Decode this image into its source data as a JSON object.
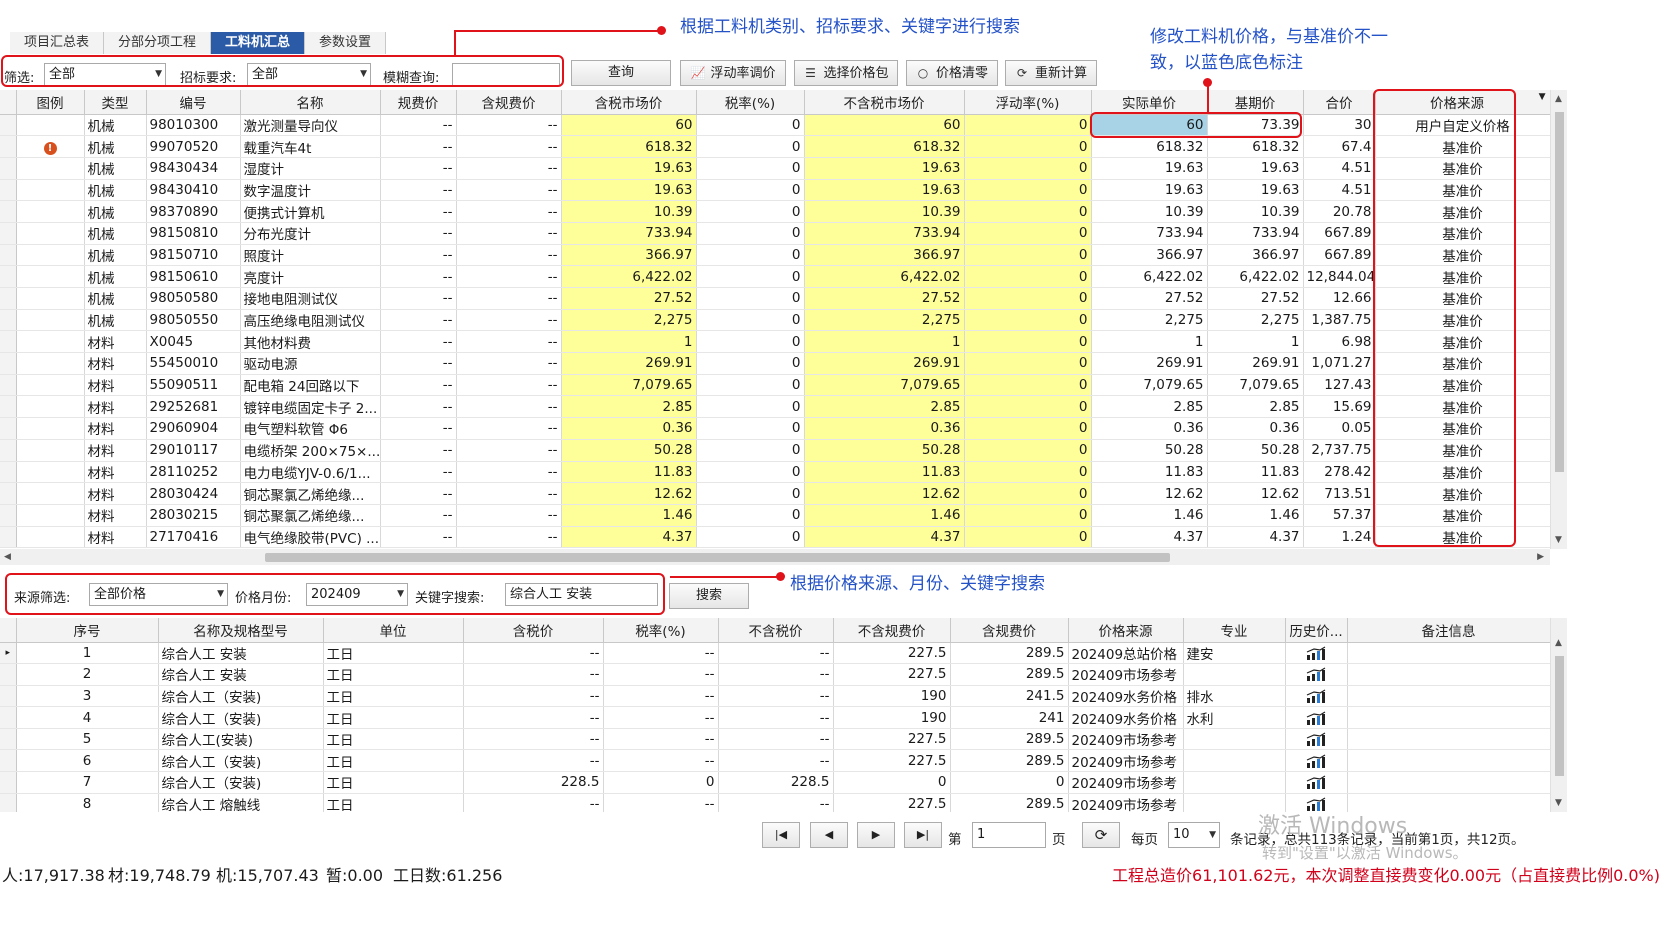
{
  "tabs": [
    {
      "label": "项目汇总表",
      "active": false
    },
    {
      "label": "分部分项工程",
      "active": false
    },
    {
      "label": "工料机汇总",
      "active": true
    },
    {
      "label": "参数设置",
      "active": false
    }
  ],
  "toolbar": {
    "filter_label": "筛选:",
    "filter_value": "全部",
    "bid_label": "招标要求:",
    "bid_value": "全部",
    "fuzzy_label": "模糊查询:",
    "fuzzy_value": "",
    "query_btn": "查询",
    "float_rate_btn": "浮动率调价",
    "select_pkg_btn": "选择价格包",
    "clear_price_btn": "价格清零",
    "recalc_btn": "重新计算"
  },
  "grid1": {
    "columns": [
      "图例",
      "类型",
      "编号",
      "名称",
      "规费价",
      "含规费价",
      "含税市场价",
      "税率(%)",
      "不含税市场价",
      "浮动率(%)",
      "实际单价",
      "基期价",
      "合价",
      "价格来源"
    ],
    "rows": [
      {
        "icon": "",
        "type": "机械",
        "code": "98010300",
        "name": "激光测量导向仪",
        "fee": "--",
        "withfee": "--",
        "taxprice": "60",
        "rate": "0",
        "notax": "60",
        "float": "0",
        "actual": "60",
        "base": "73.39",
        "total": "30",
        "source": "用户自定义价格",
        "highlight": true
      },
      {
        "icon": "warning",
        "type": "机械",
        "code": "99070520",
        "name": "载重汽车4t",
        "fee": "--",
        "withfee": "--",
        "taxprice": "618.32",
        "rate": "0",
        "notax": "618.32",
        "float": "0",
        "actual": "618.32",
        "base": "618.32",
        "total": "67.4",
        "source": "基准价"
      },
      {
        "icon": "",
        "type": "机械",
        "code": "98430434",
        "name": "湿度计",
        "fee": "--",
        "withfee": "--",
        "taxprice": "19.63",
        "rate": "0",
        "notax": "19.63",
        "float": "0",
        "actual": "19.63",
        "base": "19.63",
        "total": "4.51",
        "source": "基准价"
      },
      {
        "icon": "",
        "type": "机械",
        "code": "98430410",
        "name": "数字温度计",
        "fee": "--",
        "withfee": "--",
        "taxprice": "19.63",
        "rate": "0",
        "notax": "19.63",
        "float": "0",
        "actual": "19.63",
        "base": "19.63",
        "total": "4.51",
        "source": "基准价"
      },
      {
        "icon": "",
        "type": "机械",
        "code": "98370890",
        "name": "便携式计算机",
        "fee": "--",
        "withfee": "--",
        "taxprice": "10.39",
        "rate": "0",
        "notax": "10.39",
        "float": "0",
        "actual": "10.39",
        "base": "10.39",
        "total": "20.78",
        "source": "基准价"
      },
      {
        "icon": "",
        "type": "机械",
        "code": "98150810",
        "name": "分布光度计",
        "fee": "--",
        "withfee": "--",
        "taxprice": "733.94",
        "rate": "0",
        "notax": "733.94",
        "float": "0",
        "actual": "733.94",
        "base": "733.94",
        "total": "667.89",
        "source": "基准价"
      },
      {
        "icon": "",
        "type": "机械",
        "code": "98150710",
        "name": "照度计",
        "fee": "--",
        "withfee": "--",
        "taxprice": "366.97",
        "rate": "0",
        "notax": "366.97",
        "float": "0",
        "actual": "366.97",
        "base": "366.97",
        "total": "667.89",
        "source": "基准价"
      },
      {
        "icon": "",
        "type": "机械",
        "code": "98150610",
        "name": "亮度计",
        "fee": "--",
        "withfee": "--",
        "taxprice": "6,422.02",
        "rate": "0",
        "notax": "6,422.02",
        "float": "0",
        "actual": "6,422.02",
        "base": "6,422.02",
        "total": "12,844.04",
        "source": "基准价"
      },
      {
        "icon": "",
        "type": "机械",
        "code": "98050580",
        "name": "接地电阻测试仪",
        "fee": "--",
        "withfee": "--",
        "taxprice": "27.52",
        "rate": "0",
        "notax": "27.52",
        "float": "0",
        "actual": "27.52",
        "base": "27.52",
        "total": "12.66",
        "source": "基准价"
      },
      {
        "icon": "",
        "type": "机械",
        "code": "98050550",
        "name": "高压绝缘电阻测试仪",
        "fee": "--",
        "withfee": "--",
        "taxprice": "2,275",
        "rate": "0",
        "notax": "2,275",
        "float": "0",
        "actual": "2,275",
        "base": "2,275",
        "total": "1,387.75",
        "source": "基准价"
      },
      {
        "icon": "",
        "type": "材料",
        "code": "X0045",
        "name": "其他材料费",
        "fee": "--",
        "withfee": "--",
        "taxprice": "1",
        "rate": "0",
        "notax": "1",
        "float": "0",
        "actual": "1",
        "base": "1",
        "total": "6.98",
        "source": "基准价"
      },
      {
        "icon": "",
        "type": "材料",
        "code": "55450010",
        "name": "驱动电源",
        "fee": "--",
        "withfee": "--",
        "taxprice": "269.91",
        "rate": "0",
        "notax": "269.91",
        "float": "0",
        "actual": "269.91",
        "base": "269.91",
        "total": "1,071.27",
        "source": "基准价"
      },
      {
        "icon": "",
        "type": "材料",
        "code": "55090511",
        "name": "配电箱 24回路以下",
        "fee": "--",
        "withfee": "--",
        "taxprice": "7,079.65",
        "rate": "0",
        "notax": "7,079.65",
        "float": "0",
        "actual": "7,079.65",
        "base": "7,079.65",
        "total": "127.43",
        "source": "基准价"
      },
      {
        "icon": "",
        "type": "材料",
        "code": "29252681",
        "name": "镀锌电缆固定卡子 2...",
        "fee": "--",
        "withfee": "--",
        "taxprice": "2.85",
        "rate": "0",
        "notax": "2.85",
        "float": "0",
        "actual": "2.85",
        "base": "2.85",
        "total": "15.69",
        "source": "基准价"
      },
      {
        "icon": "",
        "type": "材料",
        "code": "29060904",
        "name": "电气塑料软管 Φ6",
        "fee": "--",
        "withfee": "--",
        "taxprice": "0.36",
        "rate": "0",
        "notax": "0.36",
        "float": "0",
        "actual": "0.36",
        "base": "0.36",
        "total": "0.05",
        "source": "基准价"
      },
      {
        "icon": "",
        "type": "材料",
        "code": "29010117",
        "name": "电缆桥架 200×75×...",
        "fee": "--",
        "withfee": "--",
        "taxprice": "50.28",
        "rate": "0",
        "notax": "50.28",
        "float": "0",
        "actual": "50.28",
        "base": "50.28",
        "total": "2,737.75",
        "source": "基准价"
      },
      {
        "icon": "",
        "type": "材料",
        "code": "28110252",
        "name": "电力电缆YJV-0.6/1...",
        "fee": "--",
        "withfee": "--",
        "taxprice": "11.83",
        "rate": "0",
        "notax": "11.83",
        "float": "0",
        "actual": "11.83",
        "base": "11.83",
        "total": "278.42",
        "source": "基准价"
      },
      {
        "icon": "",
        "type": "材料",
        "code": "28030424",
        "name": "铜芯聚氯乙烯绝缘...",
        "fee": "--",
        "withfee": "--",
        "taxprice": "12.62",
        "rate": "0",
        "notax": "12.62",
        "float": "0",
        "actual": "12.62",
        "base": "12.62",
        "total": "713.51",
        "source": "基准价"
      },
      {
        "icon": "",
        "type": "材料",
        "code": "28030215",
        "name": "铜芯聚氯乙烯绝缘...",
        "fee": "--",
        "withfee": "--",
        "taxprice": "1.46",
        "rate": "0",
        "notax": "1.46",
        "float": "0",
        "actual": "1.46",
        "base": "1.46",
        "total": "57.37",
        "source": "基准价"
      },
      {
        "icon": "",
        "type": "材料",
        "code": "27170416",
        "name": "电气绝缘胶带(PVC) ...",
        "fee": "--",
        "withfee": "--",
        "taxprice": "4.37",
        "rate": "0",
        "notax": "4.37",
        "float": "0",
        "actual": "4.37",
        "base": "4.37",
        "total": "1.24",
        "source": "基准价"
      }
    ]
  },
  "filter2": {
    "source_label": "来源筛选:",
    "source_value": "全部价格",
    "month_label": "价格月份:",
    "month_value": "202409",
    "keyword_label": "关键字搜索:",
    "keyword_value": "综合人工 安装",
    "search_btn": "搜索"
  },
  "grid2": {
    "columns": [
      "序号",
      "名称及规格型号",
      "单位",
      "含税价",
      "税率(%)",
      "不含税价",
      "不含规费价",
      "含规费价",
      "价格来源",
      "专业",
      "历史价...",
      "备注信息"
    ],
    "rows": [
      {
        "no": "1",
        "name": "综合人工 安装",
        "unit": "工日",
        "tax": "--",
        "rate": "--",
        "notax": "--",
        "nofee": "227.5",
        "fee": "289.5",
        "source": "202409总站价格",
        "major": "建安",
        "remark": ""
      },
      {
        "no": "2",
        "name": "综合人工 安装",
        "unit": "工日",
        "tax": "--",
        "rate": "--",
        "notax": "--",
        "nofee": "227.5",
        "fee": "289.5",
        "source": "202409市场参考",
        "major": "",
        "remark": ""
      },
      {
        "no": "3",
        "name": "综合人工（安装)",
        "unit": "工日",
        "tax": "--",
        "rate": "--",
        "notax": "--",
        "nofee": "190",
        "fee": "241.5",
        "source": "202409水务价格",
        "major": "排水",
        "remark": ""
      },
      {
        "no": "4",
        "name": "综合人工（安装)",
        "unit": "工日",
        "tax": "--",
        "rate": "--",
        "notax": "--",
        "nofee": "190",
        "fee": "241",
        "source": "202409水务价格",
        "major": "水利",
        "remark": ""
      },
      {
        "no": "5",
        "name": "综合人工(安装)",
        "unit": "工日",
        "tax": "--",
        "rate": "--",
        "notax": "--",
        "nofee": "227.5",
        "fee": "289.5",
        "source": "202409市场参考",
        "major": "",
        "remark": ""
      },
      {
        "no": "6",
        "name": "综合人工（安装)",
        "unit": "工日",
        "tax": "--",
        "rate": "--",
        "notax": "--",
        "nofee": "227.5",
        "fee": "289.5",
        "source": "202409市场参考",
        "major": "",
        "remark": ""
      },
      {
        "no": "7",
        "name": "综合人工（安装)",
        "unit": "工日",
        "tax": "228.5",
        "rate": "0",
        "notax": "228.5",
        "nofee": "0",
        "fee": "0",
        "source": "202409市场参考",
        "major": "",
        "remark": ""
      },
      {
        "no": "8",
        "name": "综合人工 熔触线",
        "unit": "工日",
        "tax": "--",
        "rate": "--",
        "notax": "--",
        "nofee": "227.5",
        "fee": "289.5",
        "source": "202409市场参考",
        "major": "",
        "remark": ""
      }
    ]
  },
  "pager": {
    "page_prefix": "第",
    "page_value": "1",
    "page_suffix": "页",
    "per_page_label": "每页",
    "per_page_value": "10",
    "summary": "条记录，总共113条记录，当前第1页，共12页。"
  },
  "status": {
    "labor": "人:17,917.38",
    "material": "材:19,748.79",
    "machine": "机:15,707.43",
    "temp": "暂:0.00",
    "workdays": "工日数:61.256",
    "total_note": "工程总造价61,101.62元，本次调整直接费变化0.00元（占直接费比例0.0%)"
  },
  "annotations": {
    "search_note": "根据工料机类别、招标要求、关键字进行搜索",
    "price_note_line1": "修改工料机价格，与基准价不一",
    "price_note_line2": "致，以蓝色底色标注",
    "source_note": "根据价格来源、月份、关键字搜索"
  },
  "watermark": {
    "line1": "激活 Windows",
    "line2": "转到\"设置\"以激活 Windows。"
  },
  "colors": {
    "accent_tab": "#2b5aa6",
    "market_price_bg": "#ffff99",
    "custom_price_bg": "#a8d3e6",
    "annotation_red": "#e0131a",
    "annotation_blue": "#2452c7",
    "status_red": "#d0021b"
  }
}
